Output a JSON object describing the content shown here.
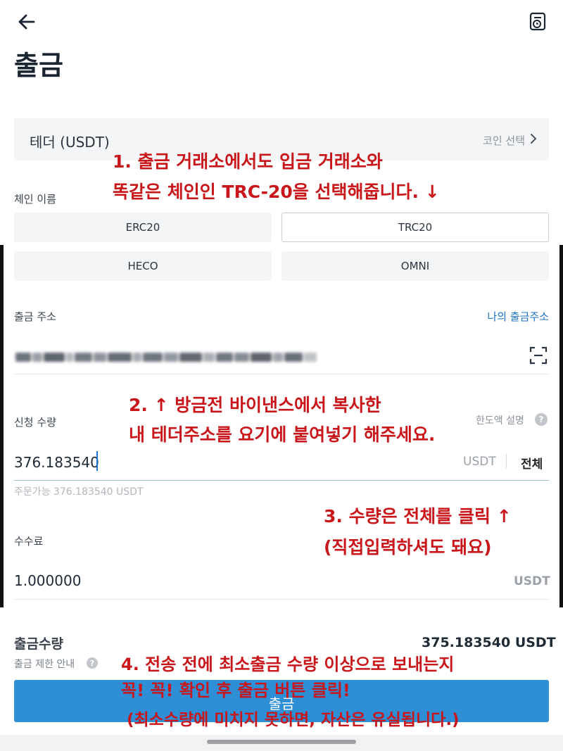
{
  "header": {
    "back_icon": "arrow-left-icon",
    "history_icon": "history-document-icon",
    "title": "출금"
  },
  "coin": {
    "name": "테더 (USDT)",
    "select_label": "코인 선택",
    "chevron_icon": "chevron-right-icon"
  },
  "chain": {
    "label": "체인 이름",
    "options": [
      "ERC20",
      "TRC20",
      "HECO",
      "OMNI"
    ],
    "selected": "TRC20"
  },
  "address": {
    "label": "출금 주소",
    "my_addresses_link": "나의 출금주소",
    "value_obscured": true,
    "scan_icon": "scan-qr-icon"
  },
  "amount": {
    "label": "신청 수량",
    "limit_help_label": "한도액 설명",
    "value": "376.183540",
    "unit": "USDT",
    "all_button": "전체",
    "available": "주문가능 376.183540 USDT"
  },
  "fee": {
    "label": "수수료",
    "value": "1.000000",
    "unit": "USDT"
  },
  "summary": {
    "total_label": "출금수량",
    "total_value": "375.183540 USDT",
    "limit_info_label": "출금 제한 안내"
  },
  "submit": {
    "label": "출금"
  },
  "annotations": {
    "step1_line1": "1. 출금 거래소에서도 입금 거래소와",
    "step1_line2": "똑같은 체인인 TRC-20을 선택해줍니다. ↓",
    "step2_line1": "2. ↑ 방금전 바이낸스에서 복사한",
    "step2_line2": "내 테더주소를 요기에 붙여넣기 해주세요.",
    "step3_line1": "3. 수량은 전체를 클릭 ↑",
    "step3_line2": "(직접입력하셔도 돼요)",
    "step4_line1": "4. 전송 전에 최소출금 수량 이상으로 보내는지",
    "step4_line2": "꼭! 꼭! 확인 후 출금 버튼 클릭!",
    "step4_line3": "(최소수량에 미치지 못하면, 자산은 유실됩니다.)",
    "color": "#c8161b"
  },
  "colors": {
    "accent": "#2f8fd6",
    "link": "#1a73c9"
  }
}
